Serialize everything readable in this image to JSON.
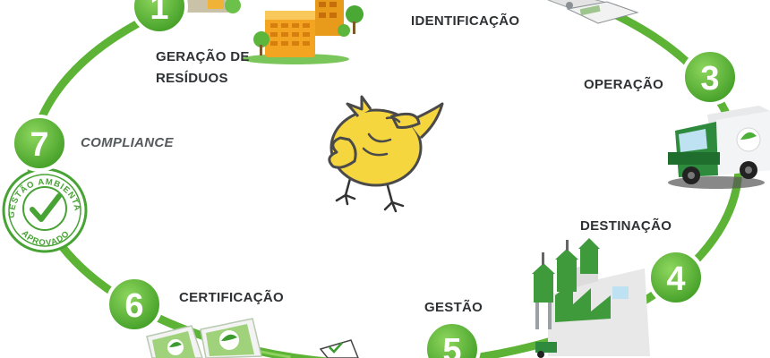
{
  "steps": [
    {
      "number": "1",
      "label_lines": [
        "GERAÇÃO DE",
        "RESÍDUOS"
      ]
    },
    {
      "label": "IDENTIFICAÇÃO"
    },
    {
      "number": "3",
      "label": "OPERAÇÃO"
    },
    {
      "number": "4",
      "label": "DESTINAÇÃO"
    },
    {
      "number": "5",
      "label": "GESTÃO"
    },
    {
      "number": "6",
      "label": "CERTIFICAÇÃO"
    },
    {
      "number": "7",
      "label": "COMPLIANCE"
    }
  ],
  "seal": {
    "top_text": "GESTÃO AMBIENTAL",
    "bottom_text": "APROVADO"
  },
  "colors": {
    "cycle_green": "#5cb335",
    "badge_green": "#55b32e",
    "badge_ring": "#ffffff",
    "label_text": "#2f3234",
    "bird_yellow": "#f6d63f",
    "truck_green": "#2e8b3e",
    "factory_green": "#3f9a3b",
    "building_orange": "#f3a521"
  },
  "icons": [
    "building-illustration",
    "scale-illustration",
    "truck-illustration",
    "factory-illustration",
    "clipboard-illustration",
    "certificate-illustration",
    "approval-seal",
    "bird-mascot"
  ]
}
